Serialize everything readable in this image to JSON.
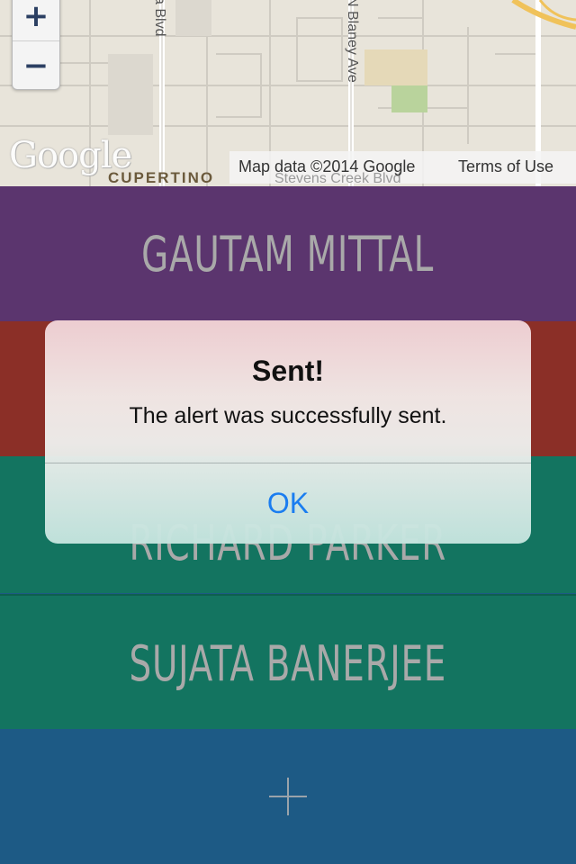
{
  "map": {
    "zoom_in_label": "+",
    "zoom_out_label": "−",
    "google_logo": "Google",
    "city_label": "CUPERTINO",
    "streets": {
      "street_a": "a Blvd",
      "street_b": "N Blaney Ave",
      "street_c": "Stevens Creek Blvd"
    },
    "attribution": "Map data ©2014 Google",
    "terms_link": "Terms of Use"
  },
  "contacts": [
    {
      "name": "GAUTAM MITTAL",
      "color": "#5b356e"
    },
    {
      "name": "",
      "color": "#8b2f27"
    },
    {
      "name": "RICHARD PARKER",
      "color": "#137460"
    },
    {
      "name": "SUJATA BANERJEE",
      "color": "#137460"
    }
  ],
  "add_button": {
    "icon": "plus-icon",
    "color": "#1d5a85"
  },
  "alert": {
    "title": "Sent!",
    "message": "The alert was successfully sent.",
    "ok_label": "OK",
    "accent": "#1a7df0"
  }
}
